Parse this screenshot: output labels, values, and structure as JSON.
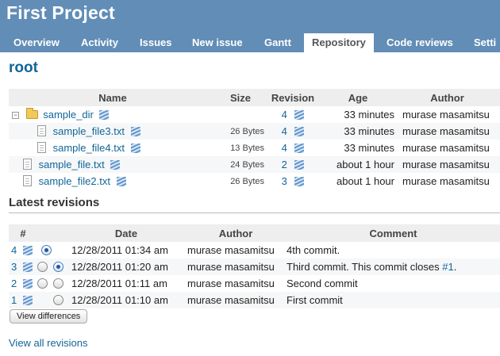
{
  "project": {
    "title": "First Project"
  },
  "menu": [
    {
      "label": "Overview"
    },
    {
      "label": "Activity"
    },
    {
      "label": "Issues"
    },
    {
      "label": "New issue"
    },
    {
      "label": "Gantt"
    },
    {
      "label": "Repository",
      "selected": true
    },
    {
      "label": "Code reviews"
    },
    {
      "label": "Setti"
    }
  ],
  "repository": {
    "title": "root",
    "columns": {
      "name": "Name",
      "size": "Size",
      "revision": "Revision",
      "age": "Age",
      "author": "Author"
    },
    "entries": [
      {
        "name": "sample_dir",
        "kind": "folder",
        "size": "",
        "revision": "4",
        "age": "33 minutes",
        "author": "murase masamitsu"
      },
      {
        "name": "sample_file3.txt",
        "kind": "file",
        "size": "26 Bytes",
        "revision": "4",
        "age": "33 minutes",
        "author": "murase masamitsu"
      },
      {
        "name": "sample_file4.txt",
        "kind": "file",
        "size": "13 Bytes",
        "revision": "4",
        "age": "33 minutes",
        "author": "murase masamitsu"
      },
      {
        "name": "sample_file.txt",
        "kind": "file",
        "size": "24 Bytes",
        "revision": "2",
        "age": "about 1 hour",
        "author": "murase masamitsu"
      },
      {
        "name": "sample_file2.txt",
        "kind": "file",
        "size": "26 Bytes",
        "revision": "3",
        "age": "about 1 hour",
        "author": "murase masamitsu"
      }
    ]
  },
  "latest": {
    "title": "Latest revisions",
    "columns": {
      "num": "#",
      "date": "Date",
      "author": "Author",
      "comment": "Comment"
    },
    "rows": [
      {
        "num": "4",
        "date": "12/28/2011 01:34 am",
        "author": "murase masamitsu",
        "comment": "4th commit.",
        "comment_link": ""
      },
      {
        "num": "3",
        "date": "12/28/2011 01:20 am",
        "author": "murase masamitsu",
        "comment": "Third commit. This commit closes ",
        "comment_link": "#1",
        "comment_tail": "."
      },
      {
        "num": "2",
        "date": "12/28/2011 01:11 am",
        "author": "murase masamitsu",
        "comment": "Second commit",
        "comment_link": ""
      },
      {
        "num": "1",
        "date": "12/28/2011 01:10 am",
        "author": "murase masamitsu",
        "comment": "First commit",
        "comment_link": ""
      }
    ],
    "view_differences_label": "View differences",
    "view_all_label": "View all revisions"
  }
}
